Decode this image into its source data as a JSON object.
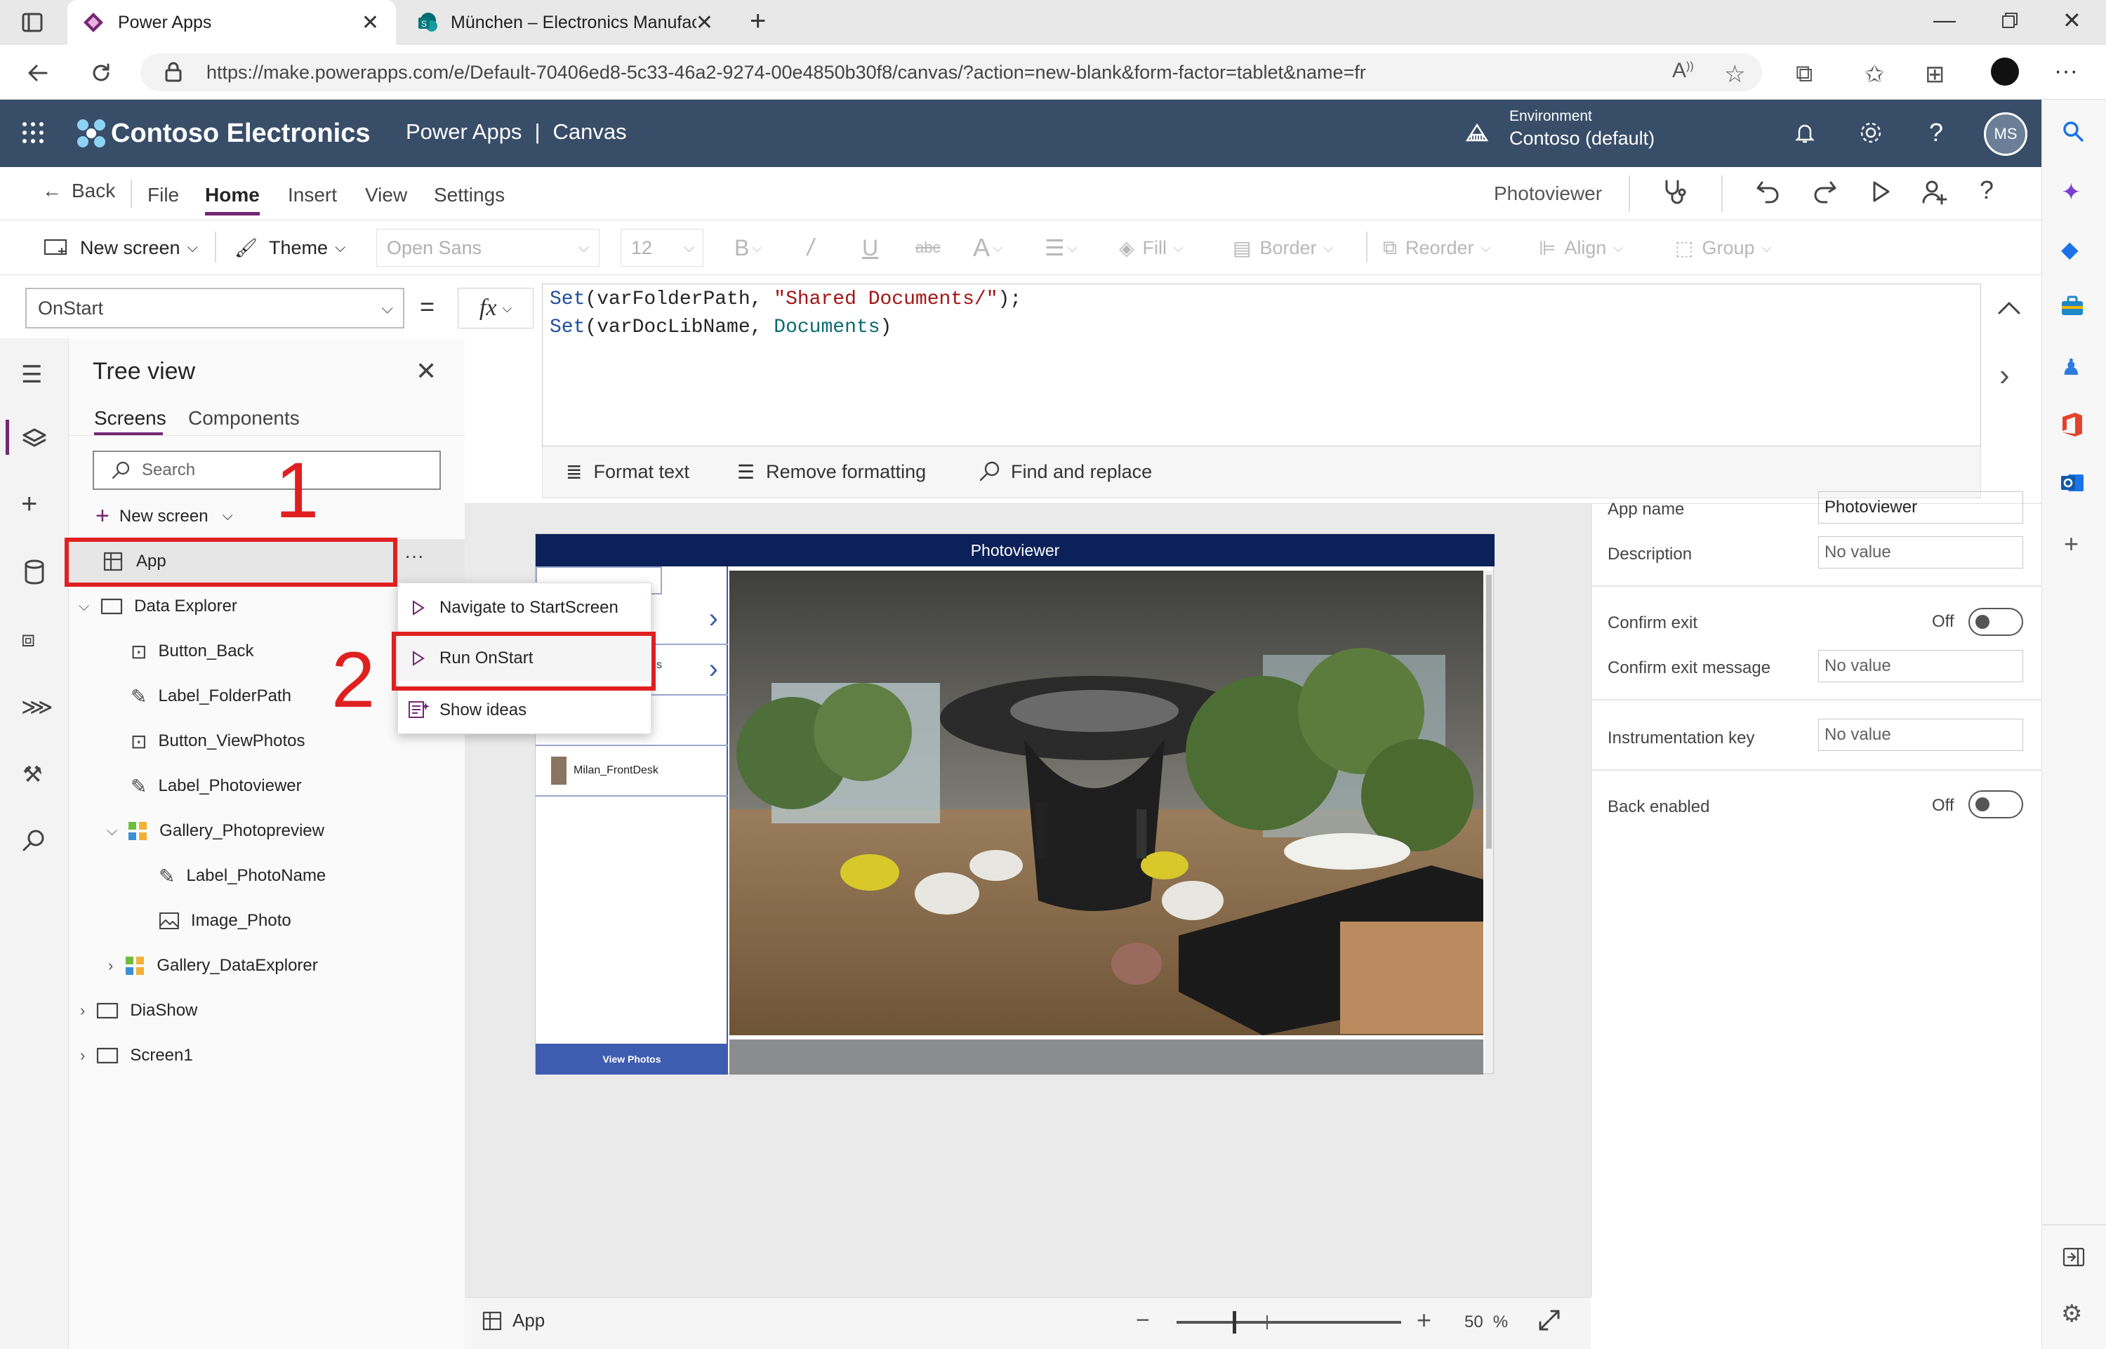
{
  "browser": {
    "tabs": [
      {
        "title": "Power Apps"
      },
      {
        "title": "München – Electronics Manufact"
      }
    ],
    "url": "https://make.powerapps.com/e/Default-70406ed8-5c33-46a2-9274-00e4850b30f8/canvas/?action=new-blank&form-factor=tablet&name=fr"
  },
  "header": {
    "brand": "Contoso Electronics",
    "product": "Power Apps",
    "separator": "|",
    "mode": "Canvas",
    "environment_label": "Environment",
    "environment_value": "Contoso (default)",
    "avatar": "MS"
  },
  "commandbar": {
    "back": "Back",
    "tabs": [
      "File",
      "Home",
      "Insert",
      "View",
      "Settings"
    ],
    "active_tab": "Home",
    "app_title": "Photoviewer"
  },
  "ribbon": {
    "new_screen": "New screen",
    "theme": "Theme",
    "font": "Open Sans",
    "font_size": "12",
    "fill": "Fill",
    "border": "Border",
    "reorder": "Reorder",
    "align": "Align",
    "group": "Group"
  },
  "formula": {
    "property": "OnStart",
    "equals": "=",
    "fx": "fx",
    "line1": {
      "fn": "Set",
      "open": "(varFolderPath, ",
      "str": "\"Shared Documents/\"",
      "close": ");"
    },
    "line2": {
      "fn": "Set",
      "open": "(varDocLibName, ",
      "ident": "Documents",
      "close": ")"
    },
    "format_text": "Format text",
    "remove_formatting": "Remove formatting",
    "find_replace": "Find and replace"
  },
  "tree": {
    "title": "Tree view",
    "tabs": [
      "Screens",
      "Components"
    ],
    "search_placeholder": "Search",
    "new_screen": "New screen",
    "nodes": [
      {
        "label": "App"
      },
      {
        "label": "Data Explorer"
      },
      {
        "label": "Button_Back"
      },
      {
        "label": "Label_FolderPath"
      },
      {
        "label": "Button_ViewPhotos"
      },
      {
        "label": "Label_Photoviewer"
      },
      {
        "label": "Gallery_Photopreview"
      },
      {
        "label": "Label_PhotoName"
      },
      {
        "label": "Image_Photo"
      },
      {
        "label": "Gallery_DataExplorer"
      },
      {
        "label": "DiaShow"
      },
      {
        "label": "Screen1"
      }
    ],
    "more": "···"
  },
  "context_menu": {
    "items": [
      "Navigate to StartScreen",
      "Run OnStart",
      "Show ideas"
    ]
  },
  "annotations": {
    "one": "1",
    "two": "2"
  },
  "canvas_app": {
    "title": "Photoviewer",
    "gallery_item": "Milan_FrontDesk",
    "partial_text": "s",
    "button": "View Photos"
  },
  "properties": {
    "app_name_label": "App name",
    "app_name_value": "Photoviewer",
    "description_label": "Description",
    "no_value": "No value",
    "confirm_exit": "Confirm exit",
    "off": "Off",
    "confirm_exit_message": "Confirm exit message",
    "instrumentation_key": "Instrumentation key",
    "back_enabled": "Back enabled"
  },
  "status": {
    "screen": "App",
    "zoom": "50",
    "percent": "%"
  }
}
